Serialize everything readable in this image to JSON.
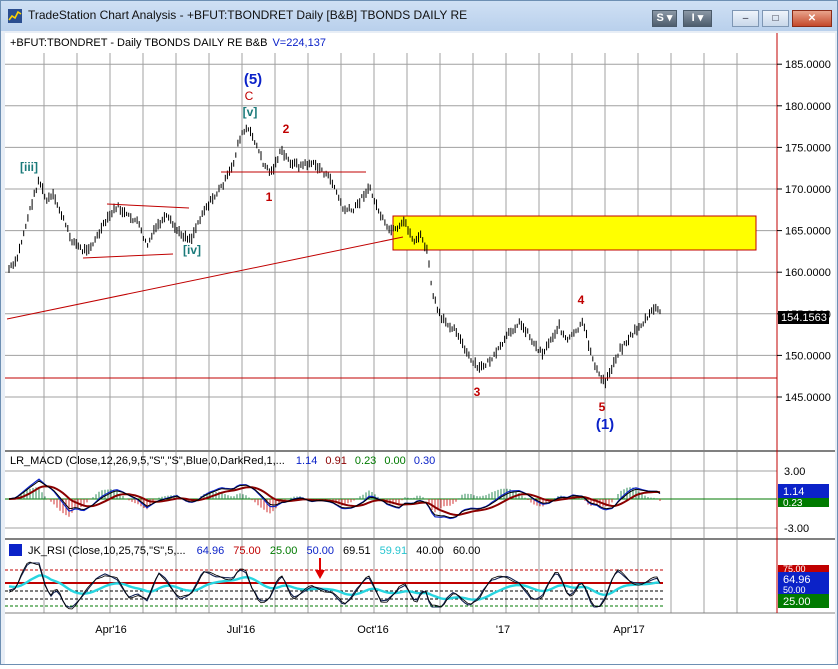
{
  "window": {
    "title": "TradeStation Chart Analysis - +BFUT:TBONDRET Daily [B&B] TBONDS DAILY RE",
    "buttons": {
      "s_label": "S",
      "i_label": "I",
      "minimize": "–",
      "maximize": "□",
      "close": "✕"
    }
  },
  "colors": {
    "accent_blue": "#0b22c8",
    "dark_red": "#c00000",
    "yellow_box": "#ffff00",
    "cyan": "#27d5e0",
    "green": "#007a00"
  },
  "price_panel": {
    "header": "+BFUT:TBONDRET - Daily  TBONDS DAILY RE  B&B",
    "volume": "V=224,137",
    "last_price": "154.1563",
    "y_ticks": [
      "185.0000",
      "180.0000",
      "175.0000",
      "170.0000",
      "165.0000",
      "160.0000",
      "155.0000",
      "150.0000",
      "145.0000"
    ],
    "labels": {
      "wave5_major": "(5)",
      "c": "C",
      "v": "[v]",
      "iii": "[iii]",
      "iv": "[iv]",
      "one": "1",
      "two": "2",
      "three": "3",
      "four": "4",
      "five": "5",
      "wave1": "(1)"
    }
  },
  "macd_panel": {
    "header": "LR_MACD (Close,12,26,9,5,\"S\",\"S\",Blue,0,DarkRed,1,...",
    "values": [
      "1.14",
      "0.91",
      "0.23",
      "0.00",
      "0.30"
    ],
    "y_ticks": [
      "3.00",
      "-3.00"
    ],
    "badges": [
      "1.14",
      "0.23"
    ]
  },
  "rsi_panel": {
    "header": "JK_RSI (Close,10,25,75,\"S\",5,...",
    "values": [
      "64.96",
      "75.00",
      "25.00",
      "50.00",
      "69.51",
      "59.91",
      "40.00",
      "60.00"
    ],
    "badges": [
      "75.00",
      "64.96",
      "50.00",
      "25.00"
    ]
  },
  "x_axis": {
    "labels": [
      "Apr'16",
      "Jul'16",
      "Oct'16",
      "'17",
      "Apr'17"
    ]
  }
}
